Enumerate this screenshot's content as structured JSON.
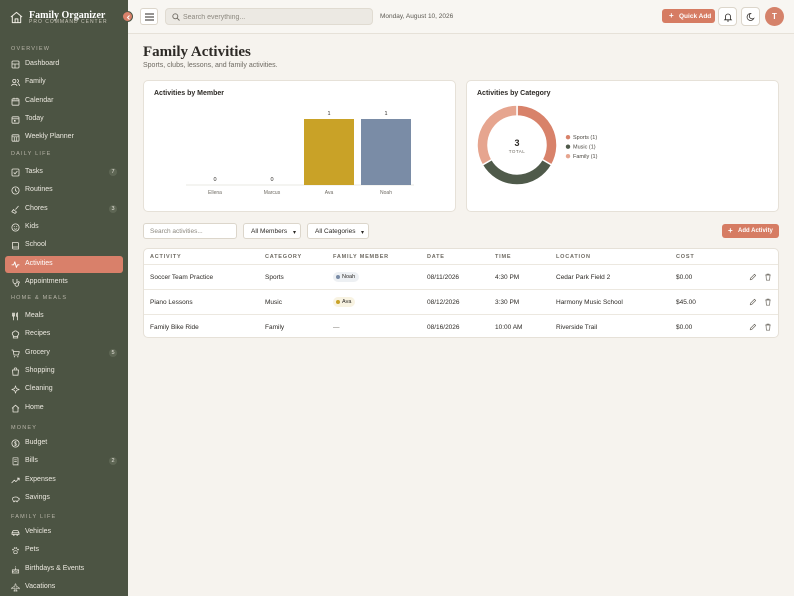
{
  "brand": {
    "title": "Family Organizer",
    "subtitle": "PRO COMMAND CENTER"
  },
  "sidebar": {
    "sections": [
      {
        "title": "OVERVIEW",
        "items": [
          {
            "label": "Dashboard",
            "icon": "dashboard-icon"
          },
          {
            "label": "Family",
            "icon": "users-icon"
          },
          {
            "label": "Calendar",
            "icon": "calendar-icon"
          },
          {
            "label": "Today",
            "icon": "today-icon"
          },
          {
            "label": "Weekly Planner",
            "icon": "planner-icon"
          }
        ]
      },
      {
        "title": "DAILY LIFE",
        "items": [
          {
            "label": "Tasks",
            "icon": "checkbox-icon",
            "badge": "7"
          },
          {
            "label": "Routines",
            "icon": "clock-icon"
          },
          {
            "label": "Chores",
            "icon": "broom-icon",
            "badge": "3"
          },
          {
            "label": "Kids",
            "icon": "smile-icon"
          },
          {
            "label": "School",
            "icon": "book-icon"
          },
          {
            "label": "Activities",
            "icon": "activity-icon",
            "active": true
          },
          {
            "label": "Appointments",
            "icon": "stethoscope-icon"
          }
        ]
      },
      {
        "title": "HOME & MEALS",
        "items": [
          {
            "label": "Meals",
            "icon": "utensils-icon"
          },
          {
            "label": "Recipes",
            "icon": "chef-hat-icon"
          },
          {
            "label": "Grocery",
            "icon": "cart-icon",
            "badge": "5"
          },
          {
            "label": "Shopping",
            "icon": "shopping-bag-icon"
          },
          {
            "label": "Cleaning",
            "icon": "sparkle-icon"
          },
          {
            "label": "Home",
            "icon": "house-icon"
          }
        ]
      },
      {
        "title": "MONEY",
        "items": [
          {
            "label": "Budget",
            "icon": "dollar-icon"
          },
          {
            "label": "Bills",
            "icon": "receipt-icon",
            "badge": "2"
          },
          {
            "label": "Expenses",
            "icon": "trend-icon"
          },
          {
            "label": "Savings",
            "icon": "piggy-bank-icon"
          }
        ]
      },
      {
        "title": "FAMILY LIFE",
        "items": [
          {
            "label": "Vehicles",
            "icon": "car-icon"
          },
          {
            "label": "Pets",
            "icon": "paw-icon"
          },
          {
            "label": "Birthdays & Events",
            "icon": "cake-icon"
          },
          {
            "label": "Vacations",
            "icon": "plane-icon"
          }
        ]
      }
    ]
  },
  "header": {
    "search_placeholder": "Search everything...",
    "date": "Monday, August 10, 2026",
    "quick_add": "Quick Add",
    "avatar_initial": "T"
  },
  "page": {
    "title": "Family Activities",
    "subtitle": "Sports, clubs, lessons, and family activities."
  },
  "bar_card": {
    "title": "Activities by Member"
  },
  "donut_card": {
    "title": "Activities by Category",
    "total_value": "3",
    "total_label": "TOTAL"
  },
  "chart_data": [
    {
      "type": "bar",
      "title": "Activities by Member",
      "categories": [
        "Ellena",
        "Marcus",
        "Ava",
        "Noah"
      ],
      "values": [
        0,
        0,
        1,
        1
      ],
      "data_labels": [
        "0",
        "0",
        "1",
        "1"
      ],
      "colors": [
        "#c9a227",
        "#c9a227",
        "#c9a227",
        "#7a8ca6"
      ],
      "ylim": [
        0,
        1
      ],
      "grid": false
    },
    {
      "type": "pie",
      "title": "Activities by Category",
      "categories": [
        "Sports",
        "Music",
        "Family"
      ],
      "values": [
        1,
        1,
        1
      ],
      "legend": [
        "Sports (1)",
        "Music (1)",
        "Family (1)"
      ],
      "colors": [
        "#d8826a",
        "#4f5a4a",
        "#e6a58f"
      ],
      "legend_position": "right",
      "donut": true
    }
  ],
  "filters": {
    "search_placeholder": "Search activities...",
    "member_select": "All Members",
    "category_select": "All Categories",
    "add_button": "Add Activity"
  },
  "table": {
    "headers": [
      "ACTIVITY",
      "CATEGORY",
      "FAMILY MEMBER",
      "DATE",
      "TIME",
      "LOCATION",
      "COST"
    ],
    "rows": [
      {
        "activity": "Soccer Team Practice",
        "category": "Sports",
        "member": "Noah",
        "member_color": "#7a8ca6",
        "date": "08/11/2026",
        "time": "4:30 PM",
        "location": "Cedar Park Field 2",
        "cost": "$0.00"
      },
      {
        "activity": "Piano Lessons",
        "category": "Music",
        "member": "Ava",
        "member_color": "#c9a227",
        "date": "08/12/2026",
        "time": "3:30 PM",
        "location": "Harmony Music School",
        "cost": "$45.00"
      },
      {
        "activity": "Family Bike Ride",
        "category": "Family",
        "member": "—",
        "member_color": "",
        "date": "08/16/2026",
        "time": "10:00 AM",
        "location": "Riverside Trail",
        "cost": "$0.00"
      }
    ]
  },
  "colors": {
    "sidebar": "#4c5443",
    "accent": "#d67c63",
    "bar_gold": "#c9a227",
    "bar_slate": "#7a8ca6"
  }
}
